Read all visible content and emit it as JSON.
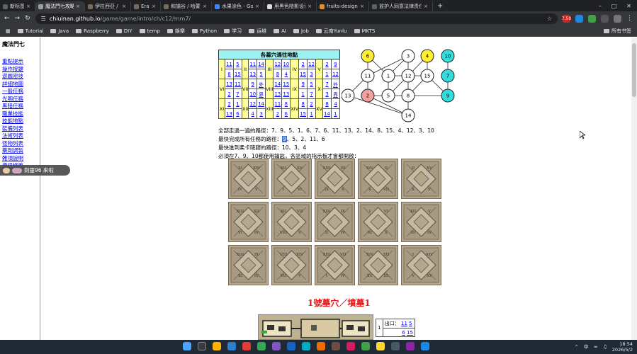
{
  "browser": {
    "tabs": [
      {
        "title": "新标签页",
        "color": "#5f6368",
        "active": false
      },
      {
        "title": "魔法門七攻略 (長影版)",
        "color": "#9aa0a6",
        "active": true
      },
      {
        "title": "伊拉西亞 / 城的西亞 (Erathia)",
        "color": "#7a6a5a",
        "active": false
      },
      {
        "title": "Erathia",
        "color": "#7a6a5a",
        "active": false
      },
      {
        "title": "和諧谷 / 哈蒙代爾 (Harm...",
        "color": "#7a6a5a",
        "active": false
      },
      {
        "title": "水果涂色 - Google 搜索",
        "color": "#4285f4",
        "active": false
      },
      {
        "title": "用黑色陰影设计的水果...",
        "color": "#dddddd",
        "active": false
      },
      {
        "title": "fruits-designed-with-bl...",
        "color": "#e58e26",
        "active": false
      },
      {
        "title": "监护人同意法律责任",
        "color": "#5f6368",
        "active": false
      }
    ],
    "new_tab": "+",
    "url_host": "chiuinan.github.io",
    "url_path": "/game/game/intro/ch/c12/mm7/",
    "ext_badge": "7.50",
    "bookmarks": [
      "Tutorial",
      "Java",
      "Raspberry",
      "DIY",
      "temp",
      "娛樂",
      "Python",
      "学习",
      "运维",
      "AI",
      "Job",
      "云南Yunlu",
      "MKTS"
    ],
    "bookmarks_right": "所有书签"
  },
  "sidebar": {
    "title": "魔法門七",
    "links": [
      "重點提示",
      "操作按鍵",
      "遊戲密技",
      "詳細地圖",
      "一般任務",
      "光明任務",
      "黑暗任務",
      "職業技能",
      "技能地點",
      "裝備列表",
      "法術列表",
      "怪物列表",
      "藥劑調製",
      "難項說明",
      "資訊修改"
    ]
  },
  "notification": {
    "text": "劍靈96 來啦"
  },
  "tomb_table": {
    "title": "各墓穴通往地點",
    "rows": [
      {
        "roman": "I",
        "cells": [
          [
            "11",
            "5"
          ],
          [
            "6",
            "15"
          ]
        ]
      },
      {
        "roman": "II",
        "cells": [
          [
            "11",
            "14"
          ],
          [
            "13",
            "5"
          ]
        ]
      },
      {
        "roman": "III",
        "cells": [
          [
            "12",
            "10"
          ],
          [
            "8",
            "4"
          ]
        ]
      },
      {
        "roman": "IV",
        "cells": [
          [
            "2",
            "12"
          ],
          [
            "15",
            "3"
          ]
        ]
      },
      {
        "roman": "V",
        "cells": [
          [
            "2",
            "9"
          ],
          [
            "1",
            "12"
          ]
        ]
      },
      {
        "roman": "VI",
        "cells": [
          [
            "13",
            "11"
          ],
          [
            "2",
            "7"
          ]
        ]
      },
      {
        "roman": "VII",
        "cells": [
          [
            "9",
            "外"
          ],
          [
            "10",
            "界"
          ]
        ]
      },
      {
        "roman": "VIII",
        "cells": [
          [
            "14",
            "15"
          ],
          [
            "13",
            "13"
          ]
        ]
      },
      {
        "roman": "IX",
        "cells": [
          [
            "9",
            "5"
          ],
          [
            "1",
            "7"
          ]
        ]
      },
      {
        "roman": "X",
        "cells": [
          [
            "10",
            "5"
          ],
          [
            "3",
            "9"
          ]
        ]
      },
      {
        "roman": "XI",
        "cells": [
          [
            "7",
            "外"
          ],
          [
            "3",
            "界"
          ]
        ]
      },
      {
        "roman": "XII",
        "cells": [
          [
            "2",
            "1"
          ],
          [
            "13",
            "6"
          ]
        ]
      },
      {
        "roman": "XIII",
        "cells": [
          [
            "12",
            "14"
          ],
          [
            "4",
            "3"
          ]
        ]
      },
      {
        "roman": "XIV",
        "cells": [
          [
            "11",
            "5"
          ],
          [
            "2",
            "6"
          ]
        ]
      },
      {
        "roman": "XV",
        "cells": [
          [
            "8",
            "4"
          ],
          [
            "14",
            "1"
          ]
        ]
      }
    ],
    "grid": [
      [
        [
          "I",
          "11",
          "5"
        ],
        [
          "II",
          "11",
          "14"
        ],
        [
          "III",
          "12",
          "10"
        ],
        [
          "IV",
          "2",
          "12"
        ],
        [
          "V",
          "2",
          "9"
        ]
      ],
      [
        [
          "",
          "6",
          "15"
        ],
        [
          "",
          "13",
          "5"
        ],
        [
          "",
          "8",
          "4"
        ],
        [
          "",
          "15",
          "3"
        ],
        [
          "",
          "1",
          "12"
        ]
      ],
      [
        [
          "VI",
          "13",
          "11"
        ],
        [
          "VII",
          "9",
          "外"
        ],
        [
          "VIII",
          "14",
          "15"
        ],
        [
          "IX",
          "9",
          "5"
        ],
        [
          "X",
          "7",
          "外"
        ]
      ],
      [
        [
          "",
          "2",
          "7"
        ],
        [
          "",
          "10",
          "界"
        ],
        [
          "",
          "13",
          "13"
        ],
        [
          "",
          "1",
          "7"
        ],
        [
          "",
          "3",
          "界"
        ]
      ],
      [
        [
          "XI",
          "2",
          "1"
        ],
        [
          "XII",
          "12",
          "14"
        ],
        [
          "XIII",
          "11",
          "8"
        ],
        [
          "XIV",
          "8",
          "2"
        ],
        [
          "XV",
          "8",
          "4"
        ]
      ],
      [
        [
          "",
          "13",
          "6"
        ],
        [
          "",
          "4",
          "3"
        ],
        [
          "",
          "2",
          "6"
        ],
        [
          "",
          "15",
          "1"
        ],
        [
          "",
          "14",
          "1"
        ]
      ]
    ]
  },
  "graph": {
    "nodes": [
      {
        "label": "6",
        "fill": "#ffee33"
      },
      {
        "label": "3",
        "fill": "#ffffff"
      },
      {
        "label": "4",
        "fill": "#ffee33"
      },
      {
        "label": "10",
        "fill": "#33dddd"
      },
      {
        "label": "11",
        "fill": "#ffffff"
      },
      {
        "label": "1",
        "fill": "#ffffff"
      },
      {
        "label": "12",
        "fill": "#ffffff"
      },
      {
        "label": "15",
        "fill": "#ffffff"
      },
      {
        "label": "7",
        "fill": "#33dddd"
      },
      {
        "label": "13",
        "fill": "#ffffff"
      },
      {
        "label": "2",
        "fill": "#f4a0a0"
      },
      {
        "label": "5",
        "fill": "#ffffff"
      },
      {
        "label": "8",
        "fill": "#ffffff"
      },
      {
        "label": "9",
        "fill": "#33dddd"
      },
      {
        "label": "14",
        "fill": "#ffffff"
      }
    ]
  },
  "text_lines": {
    "l1_label": "全部走過一遍的路徑：",
    "l1_value": "7、9、5、1、6、7、6、11、13、2、14、8、15、4、12、3、10",
    "l2_label": "最快完成所有任務的路徑：",
    "l2_hl": "9",
    "l2_value": "、5、2、11、6",
    "l3_label": "最快進到柔卡陵寢的路徑：",
    "l3_value": "10、3、4",
    "l4": "必須在7、9、10都使用鑰匙，各區域的指示板才會都開啟："
  },
  "tiles": {
    "labels": [
      [
        "XI",
        "XIV",
        "V",
        "IV"
      ],
      [
        "XII",
        "XV",
        "VI",
        "I"
      ],
      [
        "XIII",
        "III",
        "X",
        "IX"
      ],
      [
        "XIV",
        "II",
        "VII",
        "X"
      ],
      [
        "II",
        "XV",
        "V",
        "X"
      ],
      [
        "XIII",
        "XII",
        "IV",
        "VI"
      ],
      [
        "XII",
        "VII",
        "V",
        "VIII"
      ],
      [
        "XIII",
        "IX",
        "IV",
        "II"
      ],
      [
        "I",
        "VI",
        "X",
        "XI"
      ],
      [
        "XII",
        "V",
        "IV",
        "III"
      ],
      [
        "XIII",
        "IX",
        "IV",
        "XI"
      ],
      [
        "VIII",
        "XIV",
        "V",
        "VII"
      ],
      [
        "XIII",
        "VII",
        "IV",
        "I"
      ],
      [
        "XIV",
        "XII",
        "III",
        "XV"
      ],
      [
        "I",
        "XIV",
        "XV",
        "V"
      ]
    ]
  },
  "section": {
    "title": "1號墓穴／墳墓1"
  },
  "exit": {
    "index": "1",
    "label": "出口：",
    "links": [
      "11",
      "5",
      "6",
      "15"
    ]
  },
  "taskbar": {
    "lang": "中",
    "time": "18:54",
    "date": "2026/5/2"
  }
}
